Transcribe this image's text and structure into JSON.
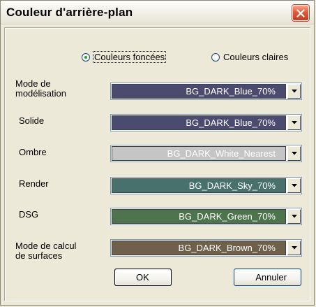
{
  "window": {
    "title": "Couleur d'arrière-plan"
  },
  "mode": {
    "options": [
      {
        "label": "Couleurs foncées",
        "selected": true
      },
      {
        "label": "Couleurs claires",
        "selected": false
      }
    ]
  },
  "rows": [
    {
      "label": "Mode de\nmodélisation",
      "value": "BG_DARK_Blue_70%",
      "color": "#4b4a6f"
    },
    {
      "label": "Solide",
      "value": "BG_DARK_Blue_70%",
      "color": "#4b4a6f"
    },
    {
      "label": "Ombre",
      "value": "BG_DARK_White_Nearest",
      "color": "#c5c5c5"
    },
    {
      "label": "Render",
      "value": "BG_DARK_Sky_70%",
      "color": "#48716e"
    },
    {
      "label": "DSG",
      "value": "BG_DARK_Green_70%",
      "color": "#4e744e"
    },
    {
      "label": "Mode de calcul\nde surfaces",
      "value": "BG_DARK_Brown_70%",
      "color": "#6f604b"
    }
  ],
  "buttons": {
    "ok": "OK",
    "cancel": "Annuler"
  }
}
